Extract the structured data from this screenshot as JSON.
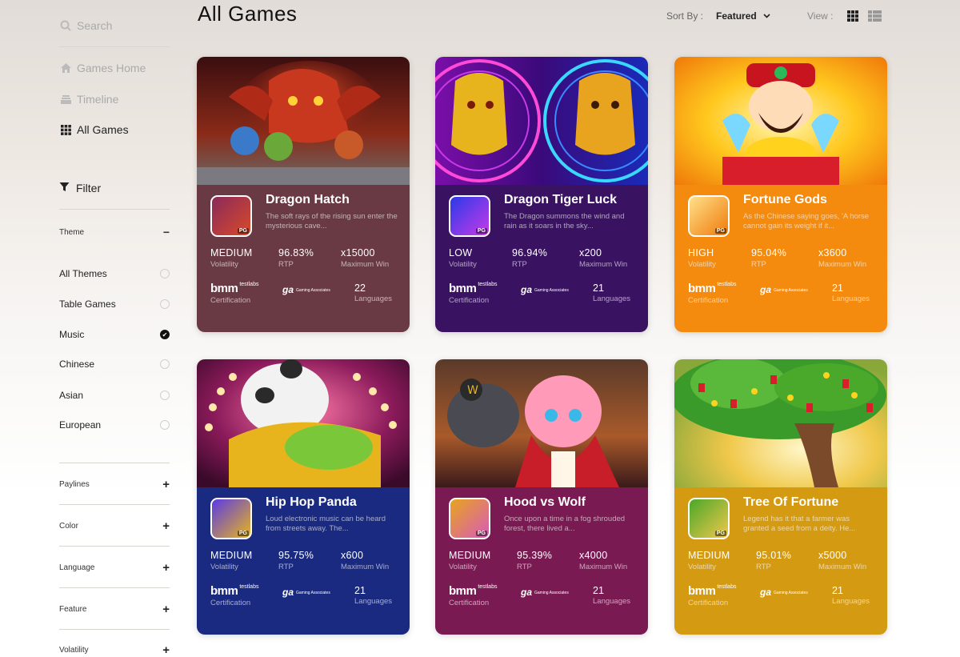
{
  "sidebar": {
    "search_placeholder": "Search",
    "nav": [
      {
        "label": "Games Home",
        "icon": "home-icon"
      },
      {
        "label": "Timeline",
        "icon": "timeline-icon"
      },
      {
        "label": "All Games",
        "icon": "grid-icon"
      }
    ],
    "filter_label": "Filter",
    "theme": {
      "label": "Theme",
      "options": [
        {
          "label": "All Themes",
          "selected": false
        },
        {
          "label": "Table Games",
          "selected": false
        },
        {
          "label": "Music",
          "selected": true
        },
        {
          "label": "Chinese",
          "selected": false
        },
        {
          "label": "Asian",
          "selected": false
        },
        {
          "label": "European",
          "selected": false
        }
      ]
    },
    "accordions": [
      "Paylines",
      "Color",
      "Language",
      "Feature",
      "Volatility"
    ]
  },
  "header": {
    "title": "All Games",
    "sort_label": "Sort By :",
    "sort_value": "Featured",
    "view_label": "View :"
  },
  "labels": {
    "volatility": "Volatility",
    "rtp": "RTP",
    "max_win": "Maximum Win",
    "certification": "Certification",
    "languages": "Languages",
    "bmm": "bmm",
    "bmm_sub": "testlabs",
    "ga": "ga",
    "ga_sub": "Gaming Associates",
    "pg": "PG"
  },
  "games": [
    {
      "name": "Dragon Hatch",
      "desc": "The soft rays of the rising sun enter the mysterious cave...",
      "volatility": "MEDIUM",
      "rtp": "96.83%",
      "max_win": "x15000",
      "languages": "22",
      "color": "#6a3a44"
    },
    {
      "name": "Dragon Tiger Luck",
      "desc": "The Dragon summons the wind and rain as it soars in the sky...",
      "volatility": "LOW",
      "rtp": "96.94%",
      "max_win": "x200",
      "languages": "21",
      "color": "#3a1262"
    },
    {
      "name": "Fortune Gods",
      "desc": "As the Chinese saying goes, 'A horse cannot gain its weight if it...",
      "volatility": "HIGH",
      "rtp": "95.04%",
      "max_win": "x3600",
      "languages": "21",
      "color": "#f48a0e"
    },
    {
      "name": "Hip Hop Panda",
      "desc": "Loud electronic music can be heard from streets away. The...",
      "volatility": "MEDIUM",
      "rtp": "95.75%",
      "max_win": "x600",
      "languages": "21",
      "color": "#1a2a80"
    },
    {
      "name": "Hood vs Wolf",
      "desc": "Once upon a time in a fog shrouded forest, there lived a...",
      "volatility": "MEDIUM",
      "rtp": "95.39%",
      "max_win": "x4000",
      "languages": "21",
      "color": "#7a1a52"
    },
    {
      "name": "Tree Of Fortune",
      "desc": "Legend has it that a farmer was granted a seed from a deity. He...",
      "volatility": "MEDIUM",
      "rtp": "95.01%",
      "max_win": "x5000",
      "languages": "21",
      "color": "#d49a12"
    }
  ]
}
